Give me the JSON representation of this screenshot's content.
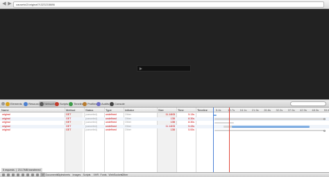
{
  "browser": {
    "url": "causeto/2/original?1323215886"
  },
  "toolbar": {
    "tabs": [
      {
        "label": "Elements",
        "color": "#d9a21b",
        "active": false
      },
      {
        "label": "Resources",
        "color": "#4b7fd0",
        "active": false
      },
      {
        "label": "Network",
        "color": "#5a5a5a",
        "active": true
      },
      {
        "label": "Scripts",
        "color": "#c23b2a",
        "active": false
      },
      {
        "label": "Timeline",
        "color": "#3d9b48",
        "active": false
      },
      {
        "label": "Profiles",
        "color": "#b87b2e",
        "active": false
      },
      {
        "label": "Audits",
        "color": "#6e6ec6",
        "active": false
      },
      {
        "label": "Console",
        "color": "#444444",
        "active": false
      }
    ]
  },
  "network": {
    "columns": {
      "name": "Name",
      "method": "Method",
      "status": "Status",
      "type": "Type",
      "initiator": "Initiator",
      "size": "Size",
      "time": "Time",
      "timeline": "Timeline"
    },
    "timeline_ticks": [
      "5.4s",
      "10.7s",
      "16.1s",
      "21.5s",
      "26.8s",
      "32.2s",
      "37.5s",
      "42.9s",
      "48.3s",
      "53.6s"
    ],
    "rows": [
      {
        "name": "original",
        "method": "GET",
        "status": "(canceled)",
        "type": "undefined",
        "initiator": "Other",
        "size": "11.14KB",
        "time": "5.13s"
      },
      {
        "name": "original",
        "method": "GET",
        "status": "(canceled)",
        "type": "undefined",
        "initiator": "Other",
        "size": "13B",
        "time": "8.30s"
      },
      {
        "name": "original",
        "method": "GET",
        "status": "(canceled)",
        "type": "undefined",
        "initiator": "Other",
        "size": "13B",
        "time": "8.30s"
      },
      {
        "name": "original",
        "method": "GET",
        "status": "(canceled)",
        "type": "undefined",
        "initiator": "Other",
        "size": "11.14KB",
        "time": "5.43s"
      },
      {
        "name": "original",
        "method": "GET",
        "status": "(canceled)",
        "type": "undefined",
        "initiator": "Other",
        "size": "13B",
        "time": "5.00s"
      }
    ]
  },
  "statusbar": {
    "summary": "5 requests ❘ 23.17MB transferred",
    "filters": [
      "All",
      "Documents",
      "Stylesheets",
      "Images",
      "Scripts",
      "XHR",
      "Fonts",
      "WebSockets",
      "Other"
    ],
    "active_filter": "All"
  },
  "colors": {
    "error_text": "#cc0000",
    "bar_blue": "#5d94d6",
    "dom_line": "#4a7fd6",
    "load_line": "#e0473b"
  }
}
